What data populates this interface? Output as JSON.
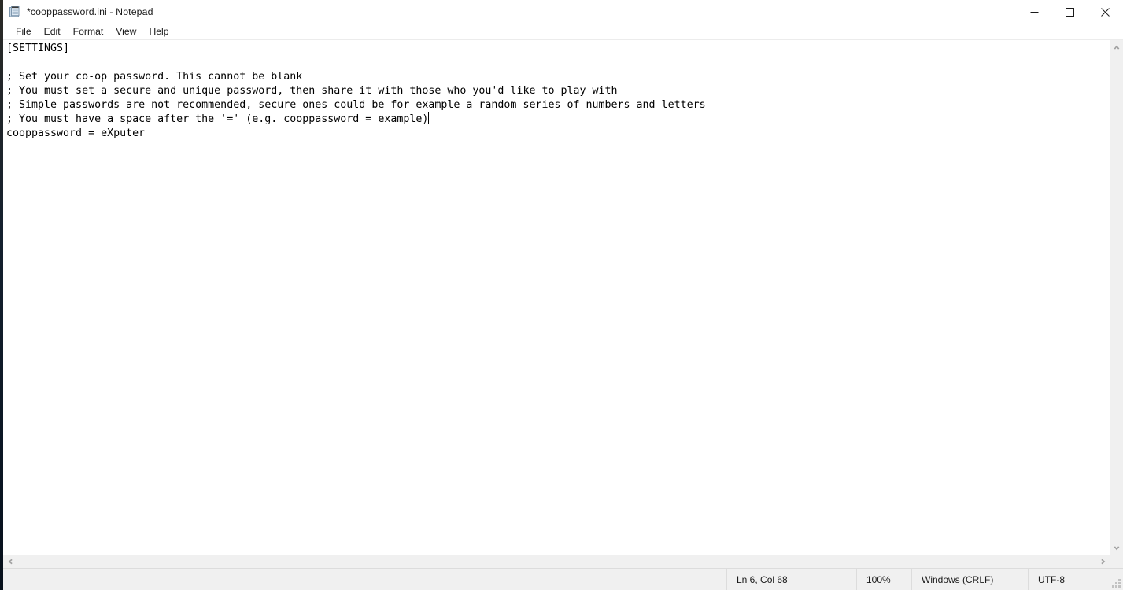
{
  "window": {
    "title": "*cooppassword.ini - Notepad",
    "app_icon": "notepad-icon",
    "controls": {
      "minimize_label": "Minimize",
      "maximize_label": "Maximize",
      "close_label": "Close"
    }
  },
  "menu": {
    "items": [
      {
        "label": "File"
      },
      {
        "label": "Edit"
      },
      {
        "label": "Format"
      },
      {
        "label": "View"
      },
      {
        "label": "Help"
      }
    ]
  },
  "editor": {
    "lines": [
      "[SETTINGS]",
      "",
      "; Set your co-op password. This cannot be blank",
      "; You must set a secure and unique password, then share it with those who you'd like to play with",
      "; Simple passwords are not recommended, secure ones could be for example a random series of numbers and letters",
      "; You must have a space after the '=' (e.g. cooppassword = example)",
      "cooppassword = eXputer"
    ],
    "text": "[SETTINGS]\n\n; Set your co-op password. This cannot be blank\n; You must set a secure and unique password, then share it with those who you'd like to play with\n; Simple passwords are not recommended, secure ones could be for example a random series of numbers and letters\n; You must have a space after the '=' (e.g. cooppassword = example)",
    "text_after_caret": "\ncooppassword = eXputer",
    "caret_line": 6,
    "caret_column": 68
  },
  "scrollbars": {
    "vertical_up_icon": "chevron-up-icon",
    "vertical_down_icon": "chevron-down-icon",
    "horizontal_left_icon": "chevron-left-icon",
    "horizontal_right_icon": "chevron-right-icon"
  },
  "status_bar": {
    "position": "Ln 6, Col 68",
    "zoom": "100%",
    "line_ending": "Windows (CRLF)",
    "encoding": "UTF-8"
  },
  "colors": {
    "window_background": "#ffffff",
    "chrome_background": "#f0f0f0",
    "text_color": "#000000",
    "divider": "#dcdcdc",
    "scrollbar_arrow": "#a0a0a0"
  }
}
